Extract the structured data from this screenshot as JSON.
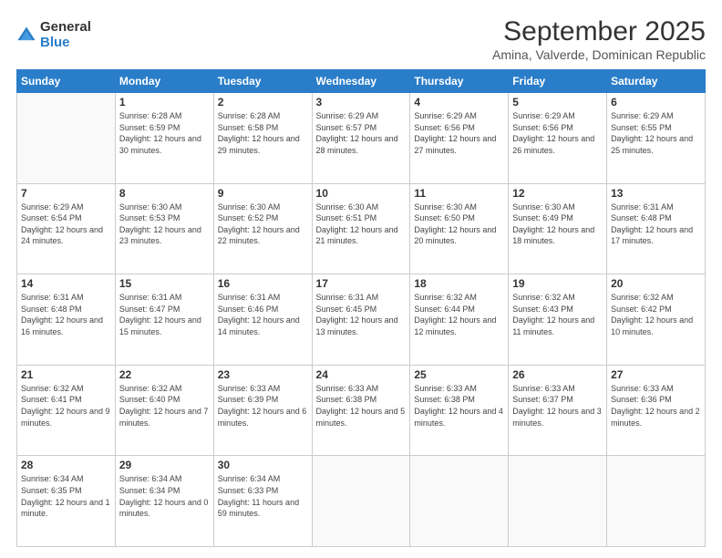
{
  "logo": {
    "general": "General",
    "blue": "Blue"
  },
  "title": "September 2025",
  "subtitle": "Amina, Valverde, Dominican Republic",
  "days_header": [
    "Sunday",
    "Monday",
    "Tuesday",
    "Wednesday",
    "Thursday",
    "Friday",
    "Saturday"
  ],
  "weeks": [
    [
      {
        "num": "",
        "sunrise": "",
        "sunset": "",
        "daylight": ""
      },
      {
        "num": "1",
        "sunrise": "Sunrise: 6:28 AM",
        "sunset": "Sunset: 6:59 PM",
        "daylight": "Daylight: 12 hours and 30 minutes."
      },
      {
        "num": "2",
        "sunrise": "Sunrise: 6:28 AM",
        "sunset": "Sunset: 6:58 PM",
        "daylight": "Daylight: 12 hours and 29 minutes."
      },
      {
        "num": "3",
        "sunrise": "Sunrise: 6:29 AM",
        "sunset": "Sunset: 6:57 PM",
        "daylight": "Daylight: 12 hours and 28 minutes."
      },
      {
        "num": "4",
        "sunrise": "Sunrise: 6:29 AM",
        "sunset": "Sunset: 6:56 PM",
        "daylight": "Daylight: 12 hours and 27 minutes."
      },
      {
        "num": "5",
        "sunrise": "Sunrise: 6:29 AM",
        "sunset": "Sunset: 6:56 PM",
        "daylight": "Daylight: 12 hours and 26 minutes."
      },
      {
        "num": "6",
        "sunrise": "Sunrise: 6:29 AM",
        "sunset": "Sunset: 6:55 PM",
        "daylight": "Daylight: 12 hours and 25 minutes."
      }
    ],
    [
      {
        "num": "7",
        "sunrise": "Sunrise: 6:29 AM",
        "sunset": "Sunset: 6:54 PM",
        "daylight": "Daylight: 12 hours and 24 minutes."
      },
      {
        "num": "8",
        "sunrise": "Sunrise: 6:30 AM",
        "sunset": "Sunset: 6:53 PM",
        "daylight": "Daylight: 12 hours and 23 minutes."
      },
      {
        "num": "9",
        "sunrise": "Sunrise: 6:30 AM",
        "sunset": "Sunset: 6:52 PM",
        "daylight": "Daylight: 12 hours and 22 minutes."
      },
      {
        "num": "10",
        "sunrise": "Sunrise: 6:30 AM",
        "sunset": "Sunset: 6:51 PM",
        "daylight": "Daylight: 12 hours and 21 minutes."
      },
      {
        "num": "11",
        "sunrise": "Sunrise: 6:30 AM",
        "sunset": "Sunset: 6:50 PM",
        "daylight": "Daylight: 12 hours and 20 minutes."
      },
      {
        "num": "12",
        "sunrise": "Sunrise: 6:30 AM",
        "sunset": "Sunset: 6:49 PM",
        "daylight": "Daylight: 12 hours and 18 minutes."
      },
      {
        "num": "13",
        "sunrise": "Sunrise: 6:31 AM",
        "sunset": "Sunset: 6:48 PM",
        "daylight": "Daylight: 12 hours and 17 minutes."
      }
    ],
    [
      {
        "num": "14",
        "sunrise": "Sunrise: 6:31 AM",
        "sunset": "Sunset: 6:48 PM",
        "daylight": "Daylight: 12 hours and 16 minutes."
      },
      {
        "num": "15",
        "sunrise": "Sunrise: 6:31 AM",
        "sunset": "Sunset: 6:47 PM",
        "daylight": "Daylight: 12 hours and 15 minutes."
      },
      {
        "num": "16",
        "sunrise": "Sunrise: 6:31 AM",
        "sunset": "Sunset: 6:46 PM",
        "daylight": "Daylight: 12 hours and 14 minutes."
      },
      {
        "num": "17",
        "sunrise": "Sunrise: 6:31 AM",
        "sunset": "Sunset: 6:45 PM",
        "daylight": "Daylight: 12 hours and 13 minutes."
      },
      {
        "num": "18",
        "sunrise": "Sunrise: 6:32 AM",
        "sunset": "Sunset: 6:44 PM",
        "daylight": "Daylight: 12 hours and 12 minutes."
      },
      {
        "num": "19",
        "sunrise": "Sunrise: 6:32 AM",
        "sunset": "Sunset: 6:43 PM",
        "daylight": "Daylight: 12 hours and 11 minutes."
      },
      {
        "num": "20",
        "sunrise": "Sunrise: 6:32 AM",
        "sunset": "Sunset: 6:42 PM",
        "daylight": "Daylight: 12 hours and 10 minutes."
      }
    ],
    [
      {
        "num": "21",
        "sunrise": "Sunrise: 6:32 AM",
        "sunset": "Sunset: 6:41 PM",
        "daylight": "Daylight: 12 hours and 9 minutes."
      },
      {
        "num": "22",
        "sunrise": "Sunrise: 6:32 AM",
        "sunset": "Sunset: 6:40 PM",
        "daylight": "Daylight: 12 hours and 7 minutes."
      },
      {
        "num": "23",
        "sunrise": "Sunrise: 6:33 AM",
        "sunset": "Sunset: 6:39 PM",
        "daylight": "Daylight: 12 hours and 6 minutes."
      },
      {
        "num": "24",
        "sunrise": "Sunrise: 6:33 AM",
        "sunset": "Sunset: 6:38 PM",
        "daylight": "Daylight: 12 hours and 5 minutes."
      },
      {
        "num": "25",
        "sunrise": "Sunrise: 6:33 AM",
        "sunset": "Sunset: 6:38 PM",
        "daylight": "Daylight: 12 hours and 4 minutes."
      },
      {
        "num": "26",
        "sunrise": "Sunrise: 6:33 AM",
        "sunset": "Sunset: 6:37 PM",
        "daylight": "Daylight: 12 hours and 3 minutes."
      },
      {
        "num": "27",
        "sunrise": "Sunrise: 6:33 AM",
        "sunset": "Sunset: 6:36 PM",
        "daylight": "Daylight: 12 hours and 2 minutes."
      }
    ],
    [
      {
        "num": "28",
        "sunrise": "Sunrise: 6:34 AM",
        "sunset": "Sunset: 6:35 PM",
        "daylight": "Daylight: 12 hours and 1 minute."
      },
      {
        "num": "29",
        "sunrise": "Sunrise: 6:34 AM",
        "sunset": "Sunset: 6:34 PM",
        "daylight": "Daylight: 12 hours and 0 minutes."
      },
      {
        "num": "30",
        "sunrise": "Sunrise: 6:34 AM",
        "sunset": "Sunset: 6:33 PM",
        "daylight": "Daylight: 11 hours and 59 minutes."
      },
      {
        "num": "",
        "sunrise": "",
        "sunset": "",
        "daylight": ""
      },
      {
        "num": "",
        "sunrise": "",
        "sunset": "",
        "daylight": ""
      },
      {
        "num": "",
        "sunrise": "",
        "sunset": "",
        "daylight": ""
      },
      {
        "num": "",
        "sunrise": "",
        "sunset": "",
        "daylight": ""
      }
    ]
  ]
}
